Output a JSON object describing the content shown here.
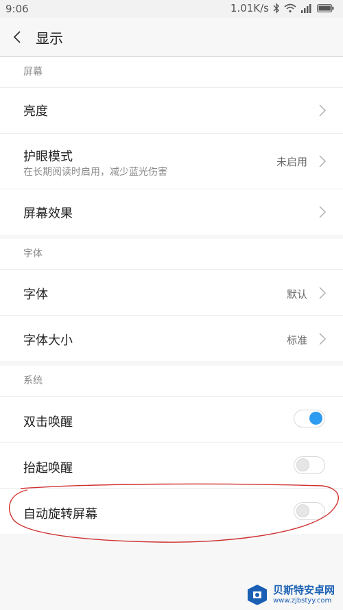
{
  "status_bar": {
    "time": "9:06",
    "speed": "1.01K/s"
  },
  "header": {
    "title": "显示"
  },
  "sections": [
    {
      "label": "屏幕",
      "rows": [
        {
          "label": "亮度"
        },
        {
          "label": "护眼模式",
          "sub": "在长期阅读时启用，减少蓝光伤害",
          "value": "未启用"
        },
        {
          "label": "屏幕效果"
        }
      ]
    },
    {
      "label": "字体",
      "rows": [
        {
          "label": "字体",
          "value": "默认"
        },
        {
          "label": "字体大小",
          "value": "标准"
        }
      ]
    },
    {
      "label": "系统",
      "rows": [
        {
          "label": "双击唤醒",
          "toggle": "on"
        },
        {
          "label": "抬起唤醒",
          "toggle": "off"
        },
        {
          "label": "自动旋转屏幕",
          "toggle": "off"
        }
      ]
    }
  ],
  "watermark": {
    "title": "贝斯特安卓网",
    "url": "www.zjbstyy.com"
  },
  "colors": {
    "accent": "#2d9bf0",
    "annotation": "#d03030"
  },
  "icons": [
    "back-arrow-icon",
    "chevron-right-icon",
    "bluetooth-icon",
    "wifi-icon",
    "signal-icon",
    "battery-icon"
  ]
}
